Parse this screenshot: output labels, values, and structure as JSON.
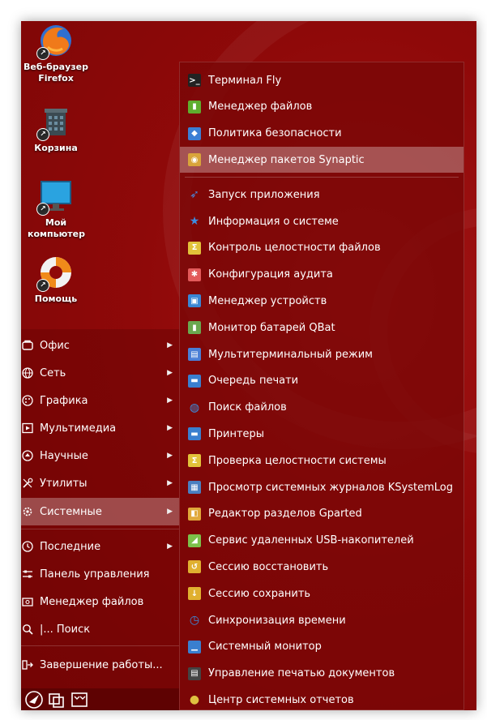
{
  "desktop_icons": [
    {
      "name": "firefox",
      "label": "Веб-браузер Firefox"
    },
    {
      "name": "trash",
      "label": "Корзина"
    },
    {
      "name": "my-computer",
      "label": "Мой компьютер"
    },
    {
      "name": "help",
      "label": "Помощь"
    }
  ],
  "main_menu": {
    "items": [
      {
        "label": "Офис",
        "icon": "office-icon",
        "has_submenu": true
      },
      {
        "label": "Сеть",
        "icon": "network-icon",
        "has_submenu": true
      },
      {
        "label": "Графика",
        "icon": "graphics-icon",
        "has_submenu": true
      },
      {
        "label": "Мультимедиа",
        "icon": "multimedia-icon",
        "has_submenu": true
      },
      {
        "label": "Научные",
        "icon": "science-icon",
        "has_submenu": true
      },
      {
        "label": "Утилиты",
        "icon": "utilities-icon",
        "has_submenu": true
      },
      {
        "label": "Системные",
        "icon": "system-icon",
        "has_submenu": true,
        "active": true
      },
      {
        "label": "Последние",
        "icon": "recent-icon",
        "has_submenu": true
      },
      {
        "label": "Панель управления",
        "icon": "control-panel-icon"
      },
      {
        "label": "Менеджер файлов",
        "icon": "file-manager-icon"
      },
      {
        "label": "|... Поиск",
        "icon": "search-icon"
      },
      {
        "label": "Завершение работы...",
        "icon": "shutdown-icon"
      }
    ]
  },
  "submenu": {
    "items": [
      {
        "label": "Терминал Fly",
        "icon": "terminal-icon",
        "color": "#222222"
      },
      {
        "label": "Менеджер файлов",
        "icon": "file-manager-icon",
        "color": "#5fae2e"
      },
      {
        "label": "Политика безопасности",
        "icon": "shield-icon",
        "color": "#3b7fd4"
      },
      {
        "label": "Менеджер пакетов Synaptic",
        "icon": "package-icon",
        "color": "#d9a43a",
        "active": true
      },
      {
        "label": "Запуск приложения",
        "icon": "rocket-icon",
        "color": "#4a86d9"
      },
      {
        "label": "Информация о системе",
        "icon": "star-icon",
        "color": "#3d8be0"
      },
      {
        "label": "Контроль целостности файлов",
        "icon": "sigma-icon",
        "color": "#e2c23a"
      },
      {
        "label": "Конфигурация аудита",
        "icon": "audit-icon",
        "color": "#e25a5a"
      },
      {
        "label": "Менеджер устройств",
        "icon": "devices-icon",
        "color": "#3a86d4"
      },
      {
        "label": "Монитор батарей QBat",
        "icon": "battery-icon",
        "color": "#6aa84f"
      },
      {
        "label": "Мультитерминальный режим",
        "icon": "multiterminal-icon",
        "color": "#4a7fd6"
      },
      {
        "label": "Очередь печати",
        "icon": "printer-icon",
        "color": "#3a7fcf"
      },
      {
        "label": "Поиск файлов",
        "icon": "magnifier-icon",
        "color": "#3a8ee0"
      },
      {
        "label": "Принтеры",
        "icon": "printer-icon",
        "color": "#3a7fcf"
      },
      {
        "label": "Проверка целостности системы",
        "icon": "sigma-icon",
        "color": "#e2c23a"
      },
      {
        "label": "Просмотр системных журналов KSystemLog",
        "icon": "log-icon",
        "color": "#4a7fc0"
      },
      {
        "label": "Редактор разделов Gparted",
        "icon": "gparted-icon",
        "color": "#e0a83a"
      },
      {
        "label": "Сервис удаленных USB-накопителей",
        "icon": "usb-icon",
        "color": "#7cc04a"
      },
      {
        "label": "Сессию восстановить",
        "icon": "session-restore-icon",
        "color": "#e0b030"
      },
      {
        "label": "Сессию сохранить",
        "icon": "session-save-icon",
        "color": "#e0b030"
      },
      {
        "label": "Синхронизация времени",
        "icon": "clock-icon",
        "color": "#3a8ee0"
      },
      {
        "label": "Системный монитор",
        "icon": "system-monitor-icon",
        "color": "#3a7fcf"
      },
      {
        "label": "Управление печатью документов",
        "icon": "print-management-icon",
        "color": "#444444"
      },
      {
        "label": "Центр системных отчетов",
        "icon": "reports-icon",
        "color": "#e0c040"
      }
    ]
  }
}
